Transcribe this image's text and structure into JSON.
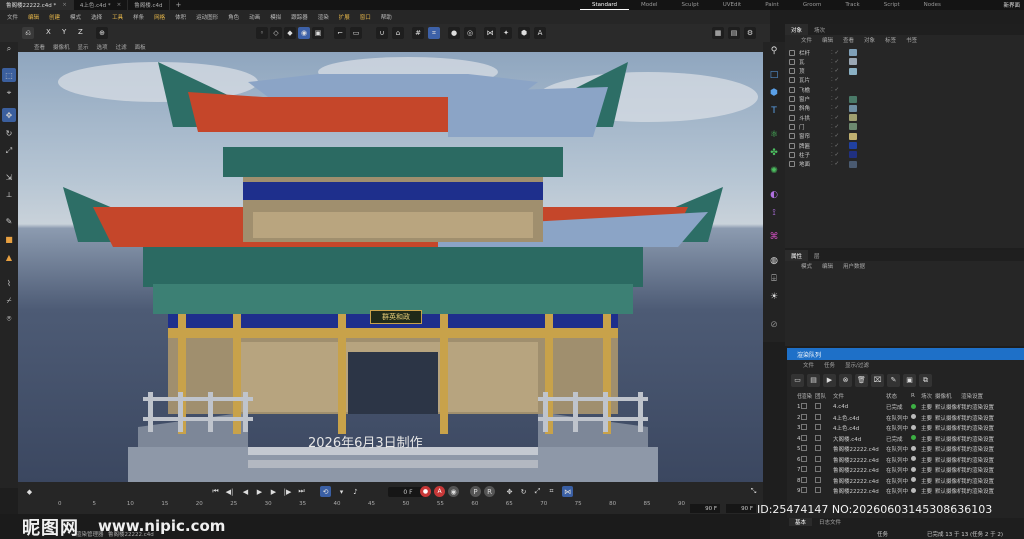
{
  "doc_tabs": [
    {
      "label": "鲁阁楼22222.c4d *",
      "active": true
    },
    {
      "label": "4上色.c4d *",
      "active": false
    },
    {
      "label": "鲁阁楼.c4d",
      "active": false
    }
  ],
  "layouts": [
    "Standard",
    "Model",
    "Sculpt",
    "UVEdit",
    "Paint",
    "Groom",
    "Track",
    "Script",
    "Nodes"
  ],
  "new_ui_label": "新界面",
  "menus": [
    "文件",
    "编辑",
    "创建",
    "模式",
    "选择",
    "工具",
    "样条",
    "网格",
    "体积",
    "运动图形",
    "角色",
    "动画",
    "模拟",
    "跟踪器",
    "渲染",
    "扩展",
    "窗口",
    "帮助"
  ],
  "toolbar": {
    "axes": [
      "X",
      "Y",
      "Z"
    ]
  },
  "viewport_menu": [
    "查看",
    "摄像机",
    "显示",
    "选项",
    "过滤",
    "面板"
  ],
  "viewport": {
    "caption": "2026年6月3日制作",
    "plaque_text": "群英和政"
  },
  "timeline": {
    "frame": "0 F",
    "ticks": [
      "0",
      "5",
      "10",
      "15",
      "20",
      "25",
      "30",
      "35",
      "40",
      "45",
      "50",
      "55",
      "60",
      "65",
      "70",
      "75",
      "80",
      "85",
      "90"
    ],
    "end_frame_a": "90 F",
    "end_frame_b": "90 F"
  },
  "status": {
    "logo": "昵图网",
    "url": "www.nipic.com",
    "render_manager": "渲染管理器",
    "file": "鲁阁楼22222.c4d"
  },
  "id_overlay": "ID:25474147 NO:20260603145308636103",
  "objects_panel": {
    "tabs": [
      "对象",
      "场次"
    ],
    "menu": [
      "文件",
      "编辑",
      "查看",
      "对象",
      "标签",
      "书签"
    ],
    "rows": [
      {
        "name": "栏杆",
        "color": "#7fa0b8"
      },
      {
        "name": "瓦",
        "color": "#9aa7b4"
      },
      {
        "name": "顶",
        "color": "#8ab0c4"
      },
      {
        "name": "瓦片",
        "color": ""
      },
      {
        "name": "飞檐",
        "color": ""
      },
      {
        "name": "窗户",
        "color": "#4a7a68"
      },
      {
        "name": "斜角",
        "color": "#6f8fa3"
      },
      {
        "name": "斗拱",
        "color": "#a0a070"
      },
      {
        "name": "门",
        "color": "#6d8a70"
      },
      {
        "name": "窗帘",
        "color": "#c0b070"
      },
      {
        "name": "牌匾",
        "color": "#2040a0"
      },
      {
        "name": "柱子",
        "color": "#203080"
      },
      {
        "name": "地面",
        "color": "#4a5a70"
      }
    ]
  },
  "attr_panel": {
    "tabs": [
      "属性",
      "层"
    ],
    "menu": [
      "模式",
      "编辑",
      "用户数据"
    ]
  },
  "render_queue": {
    "title": "渲染队列",
    "menu": [
      "文件",
      "任务",
      "显示/过滤"
    ],
    "headers": [
      "任务",
      "渲染",
      "团队",
      "文件",
      "状态",
      "R",
      "场次",
      "摄像机",
      "渲染设置"
    ],
    "rows": [
      {
        "n": "1",
        "file": "4.c4d",
        "status": "已完成",
        "dot": "#3cb043",
        "take": "主要",
        "camera": "默认摄像机",
        "preset": "我的渲染设置"
      },
      {
        "n": "2",
        "file": "4上色.c4d",
        "status": "在队列中",
        "dot": "#bbbbbb",
        "take": "主要",
        "camera": "默认摄像机",
        "preset": "我的渲染设置"
      },
      {
        "n": "3",
        "file": "4上色.c4d",
        "status": "在队列中",
        "dot": "#bbbbbb",
        "take": "主要",
        "camera": "默认摄像机",
        "preset": "我的渲染设置"
      },
      {
        "n": "4",
        "file": "大阁楼.c4d",
        "status": "已完成",
        "dot": "#3cb043",
        "take": "主要",
        "camera": "默认摄像机",
        "preset": "我的渲染设置"
      },
      {
        "n": "5",
        "file": "鲁阁楼22222.c4d",
        "status": "在队列中",
        "dot": "#bbbbbb",
        "take": "主要",
        "camera": "默认摄像机",
        "preset": "我的渲染设置"
      },
      {
        "n": "6",
        "file": "鲁阁楼22222.c4d",
        "status": "在队列中",
        "dot": "#bbbbbb",
        "take": "主要",
        "camera": "默认摄像机",
        "preset": "我的渲染设置"
      },
      {
        "n": "7",
        "file": "鲁阁楼22222.c4d",
        "status": "在队列中",
        "dot": "#bbbbbb",
        "take": "主要",
        "camera": "默认摄像机",
        "preset": "我的渲染设置"
      },
      {
        "n": "8",
        "file": "鲁阁楼22222.c4d",
        "status": "在队列中",
        "dot": "#bbbbbb",
        "take": "主要",
        "camera": "默认摄像机",
        "preset": "我的渲染设置"
      },
      {
        "n": "9",
        "file": "鲁阁楼22222.c4d",
        "status": "在队列中",
        "dot": "#bbbbbb",
        "take": "主要",
        "camera": "默认摄像机",
        "preset": "我的渲染设置"
      }
    ],
    "bottom_tabs": [
      "基本",
      "日志文件"
    ],
    "task_info": "任务",
    "progress": "已完成 13 于 13 (任务 2 于 2)"
  }
}
